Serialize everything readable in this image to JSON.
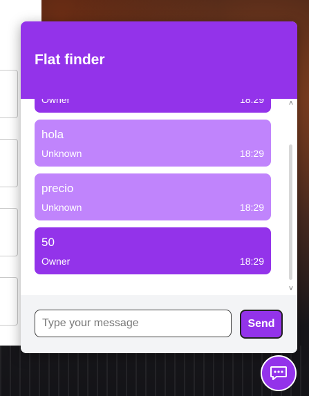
{
  "chat": {
    "title": "Flat finder",
    "messages": [
      {
        "text": "",
        "sender": "Owner",
        "time": "18:29",
        "role": "owner"
      },
      {
        "text": "hola",
        "sender": "Unknown",
        "time": "18:29",
        "role": "unknown"
      },
      {
        "text": "precio",
        "sender": "Unknown",
        "time": "18:29",
        "role": "unknown"
      },
      {
        "text": "50",
        "sender": "Owner",
        "time": "18:29",
        "role": "owner"
      }
    ],
    "input": {
      "placeholder": "Type your message",
      "value": ""
    },
    "send_label": "Send"
  },
  "icons": {
    "fab": "chat-bubble-icon",
    "scroll_up": "chevron-up-icon",
    "scroll_down": "chevron-down-icon"
  },
  "colors": {
    "accent": "#9333ea",
    "accent_light": "#c084fc",
    "footer_bg": "#f3f4f6"
  }
}
